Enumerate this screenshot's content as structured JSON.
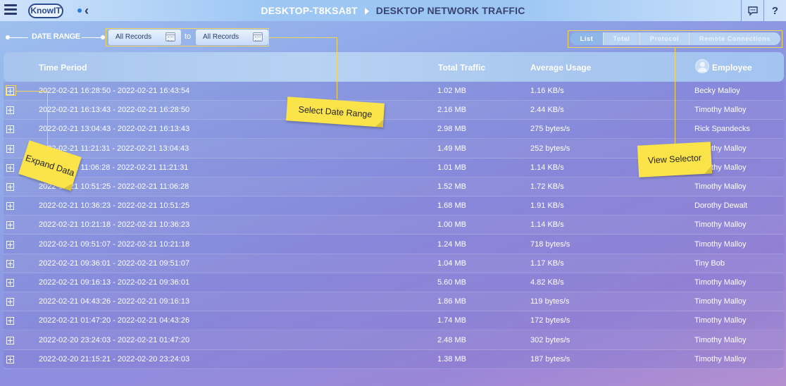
{
  "topbar": {
    "logo": "KnowIT",
    "crumb_device": "DESKTOP-T8KSA8T",
    "crumb_page": "DESKTOP NETWORK TRAFFIC",
    "help": "?"
  },
  "date_range": {
    "label": "DATE RANGE",
    "from": "All Records",
    "to_label": "to",
    "to": "All Records"
  },
  "view_selector": {
    "tabs": [
      "List",
      "Total",
      "Protocol",
      "Remote Connections"
    ],
    "active": "List"
  },
  "table": {
    "headers": {
      "time_period": "Time Period",
      "total_traffic": "Total Traffic",
      "average_usage": "Average Usage",
      "employee": "Employee"
    },
    "rows": [
      {
        "period": "2022-02-21 16:28:50 - 2022-02-21 16:43:54",
        "traffic": "1.02 MB",
        "usage": "1.16 KB/s",
        "employee": "Becky Malloy"
      },
      {
        "period": "2022-02-21 16:13:43 - 2022-02-21 16:28:50",
        "traffic": "2.16 MB",
        "usage": "2.44 KB/s",
        "employee": "Timothy Malloy"
      },
      {
        "period": "2022-02-21 13:04:43 - 2022-02-21 16:13:43",
        "traffic": "2.98 MB",
        "usage": "275 bytes/s",
        "employee": "Rick Spandecks"
      },
      {
        "period": "2022-02-21 11:21:31 - 2022-02-21 13:04:43",
        "traffic": "1.49 MB",
        "usage": "252 bytes/s",
        "employee": "Timothy Malloy"
      },
      {
        "period": "2022-02-21 11:06:28 - 2022-02-21 11:21:31",
        "traffic": "1.01 MB",
        "usage": "1.14 KB/s",
        "employee": "Timothy Malloy"
      },
      {
        "period": "2022-02-21 10:51:25 - 2022-02-21 11:06:28",
        "traffic": "1.52 MB",
        "usage": "1.72 KB/s",
        "employee": "Timothy Malloy"
      },
      {
        "period": "2022-02-21 10:36:23 - 2022-02-21 10:51:25",
        "traffic": "1.68 MB",
        "usage": "1.91 KB/s",
        "employee": "Dorothy Dewalt"
      },
      {
        "period": "2022-02-21 10:21:18 - 2022-02-21 10:36:23",
        "traffic": "1.00 MB",
        "usage": "1.14 KB/s",
        "employee": "Timothy Malloy"
      },
      {
        "period": "2022-02-21 09:51:07 - 2022-02-21 10:21:18",
        "traffic": "1.24 MB",
        "usage": "718 bytes/s",
        "employee": "Timothy Malloy"
      },
      {
        "period": "2022-02-21 09:36:01 - 2022-02-21 09:51:07",
        "traffic": "1.04 MB",
        "usage": "1.17 KB/s",
        "employee": "Tiny Bob"
      },
      {
        "period": "2022-02-21 09:16:13 - 2022-02-21 09:36:01",
        "traffic": "5.60 MB",
        "usage": "4.82 KB/s",
        "employee": "Timothy Malloy"
      },
      {
        "period": "2022-02-21 04:43:26 - 2022-02-21 09:16:13",
        "traffic": "1.86 MB",
        "usage": "119 bytes/s",
        "employee": "Timothy Malloy"
      },
      {
        "period": "2022-02-21 01:47:20 - 2022-02-21 04:43:26",
        "traffic": "1.74 MB",
        "usage": "172 bytes/s",
        "employee": "Timothy Malloy"
      },
      {
        "period": "2022-02-20 23:24:03 - 2022-02-21 01:47:20",
        "traffic": "2.48 MB",
        "usage": "302 bytes/s",
        "employee": "Timothy Malloy"
      },
      {
        "period": "2022-02-20 21:15:21 - 2022-02-20 23:24:03",
        "traffic": "1.38 MB",
        "usage": "187 bytes/s",
        "employee": "Timothy Malloy"
      }
    ]
  },
  "annotations": {
    "date_range": "Select Date Range",
    "expand": "Expand Data",
    "view": "View Selector"
  },
  "icons": [
    "hamburger-icon",
    "chevron-left-icon",
    "chat-icon",
    "help-icon",
    "calendar-icon",
    "expand-icon",
    "employee-icon"
  ],
  "colors": {
    "note": "#fbe34a",
    "highlight": "#f2d65a"
  }
}
